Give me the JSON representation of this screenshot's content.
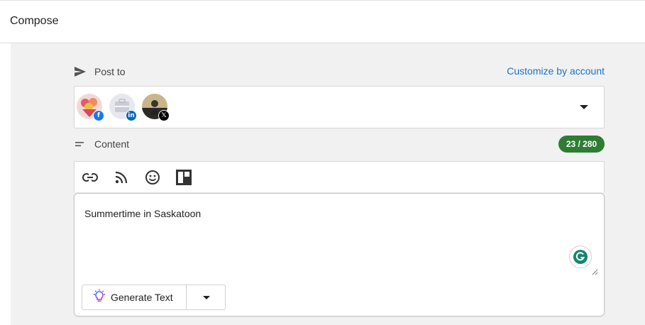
{
  "header": {
    "title": "Compose"
  },
  "post_to": {
    "label": "Post to",
    "icon": "send-icon",
    "customize_link": "Customize by account",
    "accounts": [
      {
        "network": "facebook",
        "badge_icon": "facebook-icon",
        "badge_color": "#1877f2"
      },
      {
        "network": "linkedin",
        "badge_icon": "linkedin-icon",
        "badge_color": "#0a66c2"
      },
      {
        "network": "x",
        "badge_icon": "x-icon",
        "badge_color": "#000000"
      }
    ]
  },
  "content": {
    "label": "Content",
    "icon": "short-text-icon",
    "counter": "23 / 280",
    "counter_color": "#2e7d32",
    "toolbar": [
      "link-icon",
      "rss-icon",
      "emoji-icon",
      "layout-icon"
    ],
    "text": "Summertime in Saskatoon",
    "generate_label": "Generate Text"
  }
}
